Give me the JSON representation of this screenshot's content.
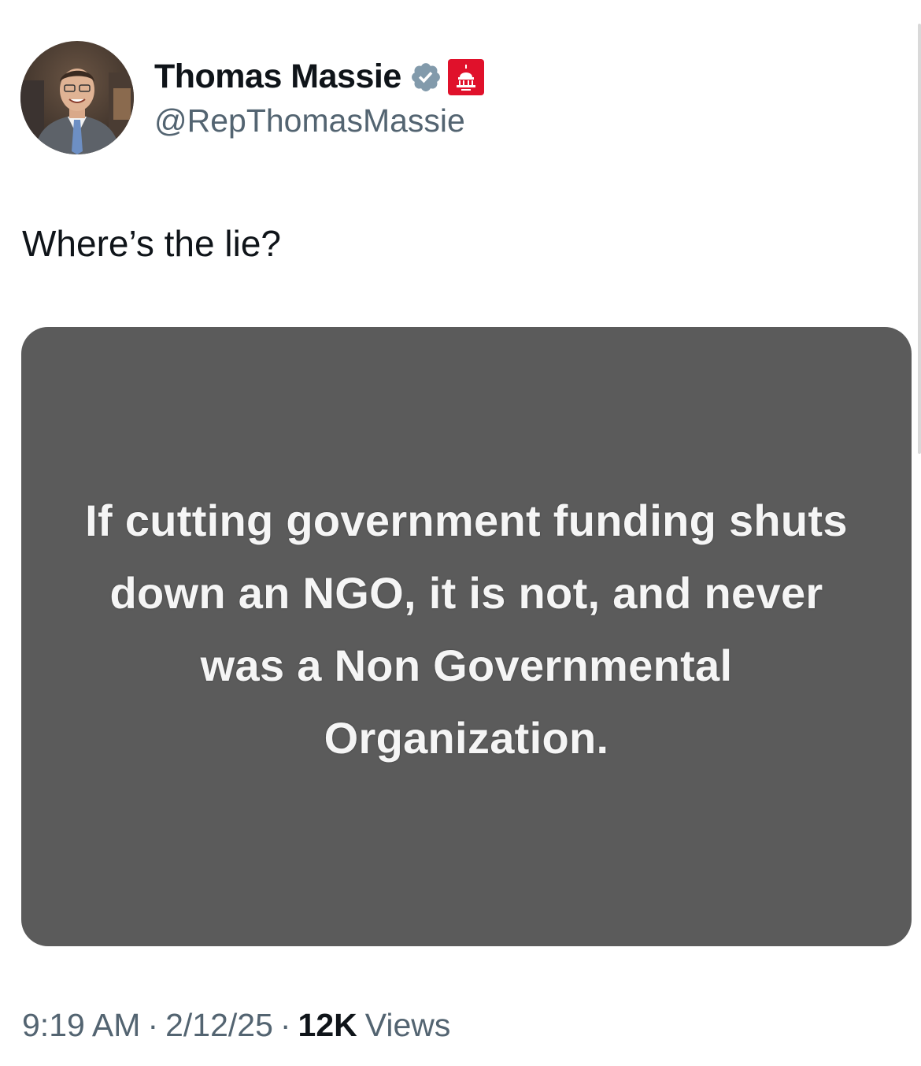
{
  "author": {
    "display_name": "Thomas Massie",
    "handle": "@RepThomasMassie",
    "verified_icon": "verified-badge-icon",
    "affiliation_icon": "capitol-dome-icon",
    "brand_colors": {
      "verified": "#829aab",
      "affiliation": "#e0112b"
    }
  },
  "tweet": {
    "text": "Where’s the lie?",
    "media_text": "If cutting government funding shuts down an NGO, it is not, and never was a Non Governmental Organization.",
    "media_background": "#5b5b5b"
  },
  "meta": {
    "time": "9:19 AM",
    "separator": "·",
    "date": "2/12/25",
    "views_count": "12K",
    "views_label": "Views"
  }
}
